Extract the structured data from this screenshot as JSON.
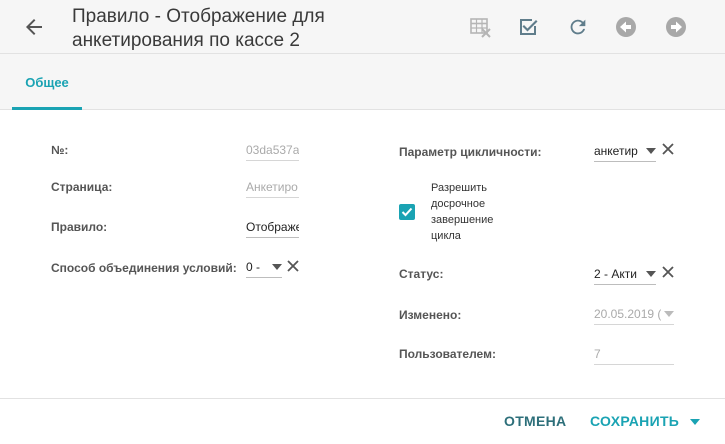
{
  "header": {
    "title": "Правило - Отображение для анкетирования по кассе 2",
    "icons": [
      "back-arrow-icon",
      "table-delete-icon",
      "checkbox-checked-icon",
      "refresh-icon",
      "previous-icon",
      "next-icon"
    ]
  },
  "tabs": [
    {
      "label": "Общее",
      "active": true
    }
  ],
  "form": {
    "number": {
      "label": "№:",
      "value": "03da537a"
    },
    "page": {
      "label": "Страница:",
      "value": "Анкетиро"
    },
    "rule": {
      "label": "Правило:",
      "value": "Отображе"
    },
    "join": {
      "label": "Способ объединения условий:",
      "value": "0 -"
    },
    "cycle_param": {
      "label": "Параметр цикличности:",
      "value": "анкетир"
    },
    "early_finish": {
      "label": "Разрешить досрочное завершение цикла",
      "checked": true
    },
    "status": {
      "label": "Статус:",
      "value": "2 - Акти"
    },
    "modified": {
      "label": "Изменено:",
      "value": "20.05.2019 ("
    },
    "user": {
      "label": "Пользователем:",
      "value": "7"
    }
  },
  "footer": {
    "cancel_label": "ОТМЕНА",
    "save_label": "СОХРАНИТЬ"
  },
  "colors": {
    "accent": "#1aa3b3",
    "header_bg": "#f6f6f6"
  }
}
